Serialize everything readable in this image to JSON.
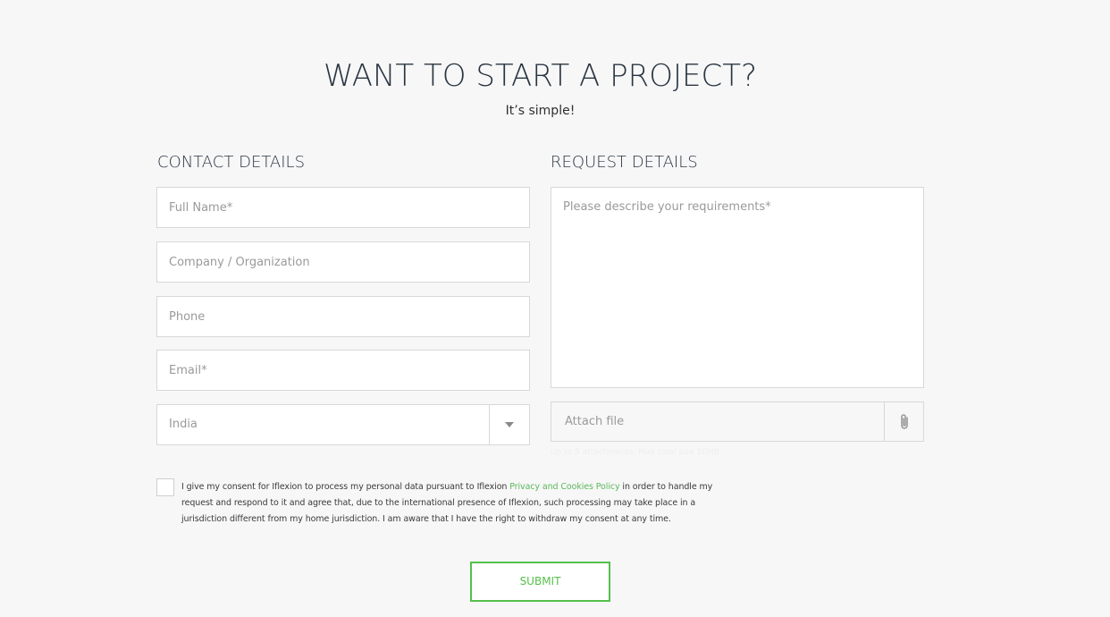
{
  "header": {
    "title": "WANT TO START A PROJECT?",
    "subtitle": "It’s simple!"
  },
  "contact": {
    "section_title": "CONTACT DETAILS",
    "full_name_placeholder": "Full Name*",
    "company_placeholder": "Company / Organization",
    "phone_placeholder": "Phone",
    "email_placeholder": "Email*",
    "country_value": "India"
  },
  "request": {
    "section_title": "REQUEST DETAILS",
    "requirements_placeholder": "Please describe your requirements*",
    "attach_label": "Attach file",
    "attach_hint": "Up to 5 attachments. Max total size 10MB"
  },
  "consent": {
    "text_before": "I give my consent for Iflexion to process my personal data pursuant to Iflexion ",
    "link_text": "Privacy and Cookies Policy",
    "text_after": " in order to handle my request and respond to it and agree that, due to the international presence of Iflexion, such processing may take place in a jurisdiction different from my home jurisdiction. I am aware that I have the right to withdraw my consent at any time."
  },
  "submit_label": "SUBMIT",
  "icons": {
    "dropdown": "chevron-down-icon",
    "attach": "paperclip-icon"
  },
  "colors": {
    "accent": "#55c04a",
    "link": "#5cb85c",
    "heading": "#2a3542",
    "background": "#f7f7f7"
  }
}
